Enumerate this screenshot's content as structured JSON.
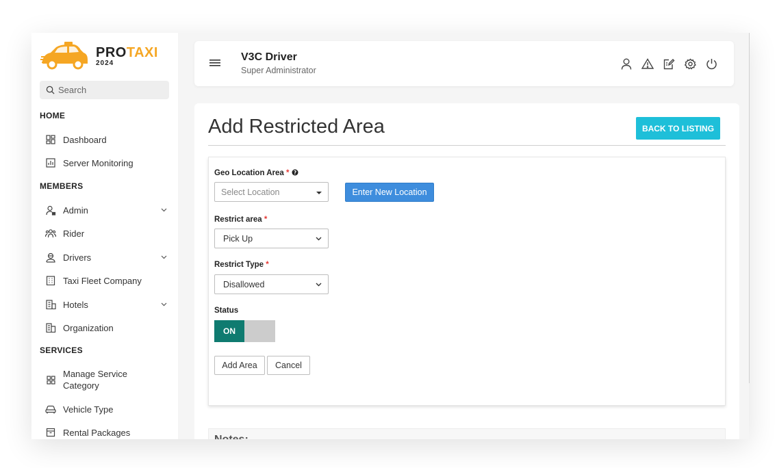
{
  "sidebar": {
    "logo": {
      "name_main": "PRO",
      "name_accent": "TAXI",
      "year": "2024",
      "icon": "taxi-car-icon"
    },
    "search": {
      "placeholder": "Search",
      "icon": "search-icon"
    },
    "sections": [
      {
        "title": "HOME",
        "items": [
          {
            "label": "Dashboard",
            "icon": "dashboard-icon"
          },
          {
            "label": "Server Monitoring",
            "icon": "chart-icon"
          }
        ]
      },
      {
        "title": "MEMBERS",
        "items": [
          {
            "label": "Admin",
            "icon": "admin-user-icon",
            "expandable": true
          },
          {
            "label": "Rider",
            "icon": "group-icon"
          },
          {
            "label": "Drivers",
            "icon": "driver-icon",
            "expandable": true
          },
          {
            "label": "Taxi Fleet Company",
            "icon": "building-icon"
          },
          {
            "label": "Hotels",
            "icon": "hotel-icon",
            "expandable": true
          },
          {
            "label": "Organization",
            "icon": "organization-icon"
          }
        ]
      },
      {
        "title": "SERVICES",
        "items": [
          {
            "label": "Manage Service Category",
            "icon": "grid-icon"
          },
          {
            "label": "Vehicle Type",
            "icon": "car-icon"
          },
          {
            "label": "Rental Packages",
            "icon": "package-icon"
          }
        ]
      }
    ]
  },
  "header": {
    "title": "V3C Driver",
    "subtitle": "Super Administrator",
    "icons": [
      "user-icon",
      "alert-icon",
      "edit-icon",
      "settings-icon",
      "power-icon"
    ]
  },
  "page": {
    "title": "Add Restricted Area",
    "back_label": "BACK TO LISTING"
  },
  "form": {
    "geo_label": "Geo Location Area",
    "geo_placeholder": "Select Location",
    "new_location_label": "Enter New Location",
    "restrict_area_label": "Restrict area",
    "restrict_area_value": "Pick Up",
    "restrict_type_label": "Restrict Type",
    "restrict_type_value": "Disallowed",
    "status_label": "Status",
    "status_value": "ON",
    "required_mark": "*",
    "add_label": "Add Area",
    "cancel_label": "Cancel"
  },
  "notes": {
    "title": "Notes:"
  },
  "colors": {
    "accent": "#1ebfd9",
    "primary": "#3e8ddd",
    "toggle_on": "#0f7b70",
    "logo_accent": "#f5a623",
    "required": "#e53935"
  }
}
